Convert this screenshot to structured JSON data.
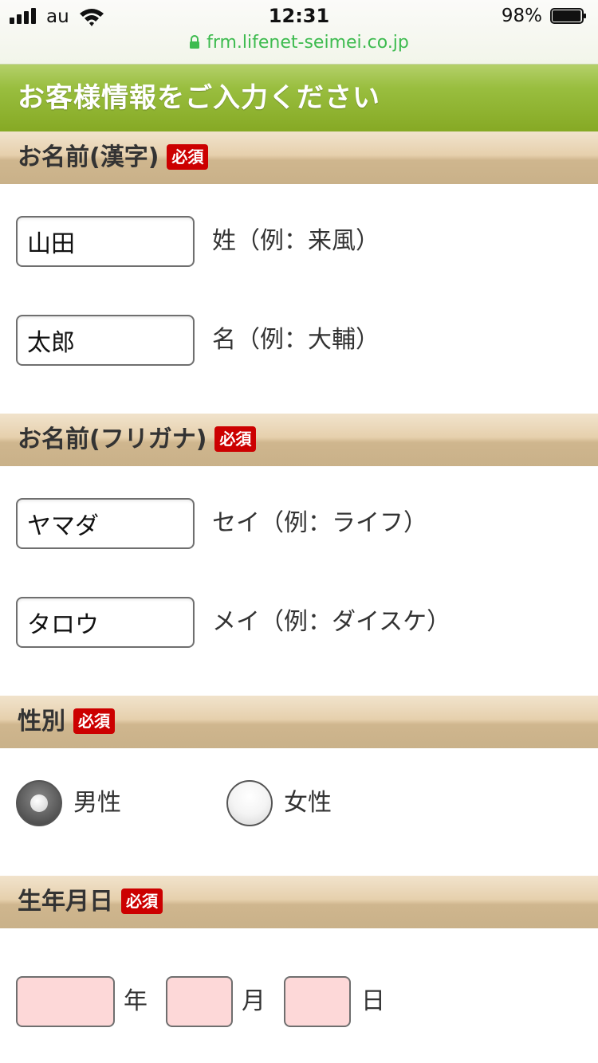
{
  "status_bar": {
    "carrier": "au",
    "time": "12:31",
    "battery_percent": "98%",
    "battery_level": 0.98,
    "url": "frm.lifenet-seimei.co.jp"
  },
  "page_title": "お客様情報をご入力ください",
  "required_badge": "必須",
  "sections": {
    "name_kanji": {
      "label": "お名前(漢字)",
      "last_name": {
        "value": "山田",
        "hint": "姓（例：来風）"
      },
      "first_name": {
        "value": "太郎",
        "hint": "名（例：大輔）"
      }
    },
    "name_kana": {
      "label": "お名前(フリガナ)",
      "last_name": {
        "value": "ヤマダ",
        "hint": "セイ（例：ライフ）"
      },
      "first_name": {
        "value": "タロウ",
        "hint": "メイ（例：ダイスケ）"
      }
    },
    "gender": {
      "label": "性別",
      "options": [
        {
          "label": "男性",
          "checked": true
        },
        {
          "label": "女性",
          "checked": false
        }
      ]
    },
    "birthday": {
      "label": "生年月日",
      "year_unit": "年",
      "month_unit": "月",
      "day_unit": "日",
      "year_value": "",
      "month_value": "",
      "day_value": ""
    }
  },
  "colors": {
    "title_green": "#86a924",
    "section_tan": "#c9b189",
    "required_red": "#cc0000",
    "date_field_pink": "#fdd8d8",
    "url_green": "#3dbb4f"
  }
}
